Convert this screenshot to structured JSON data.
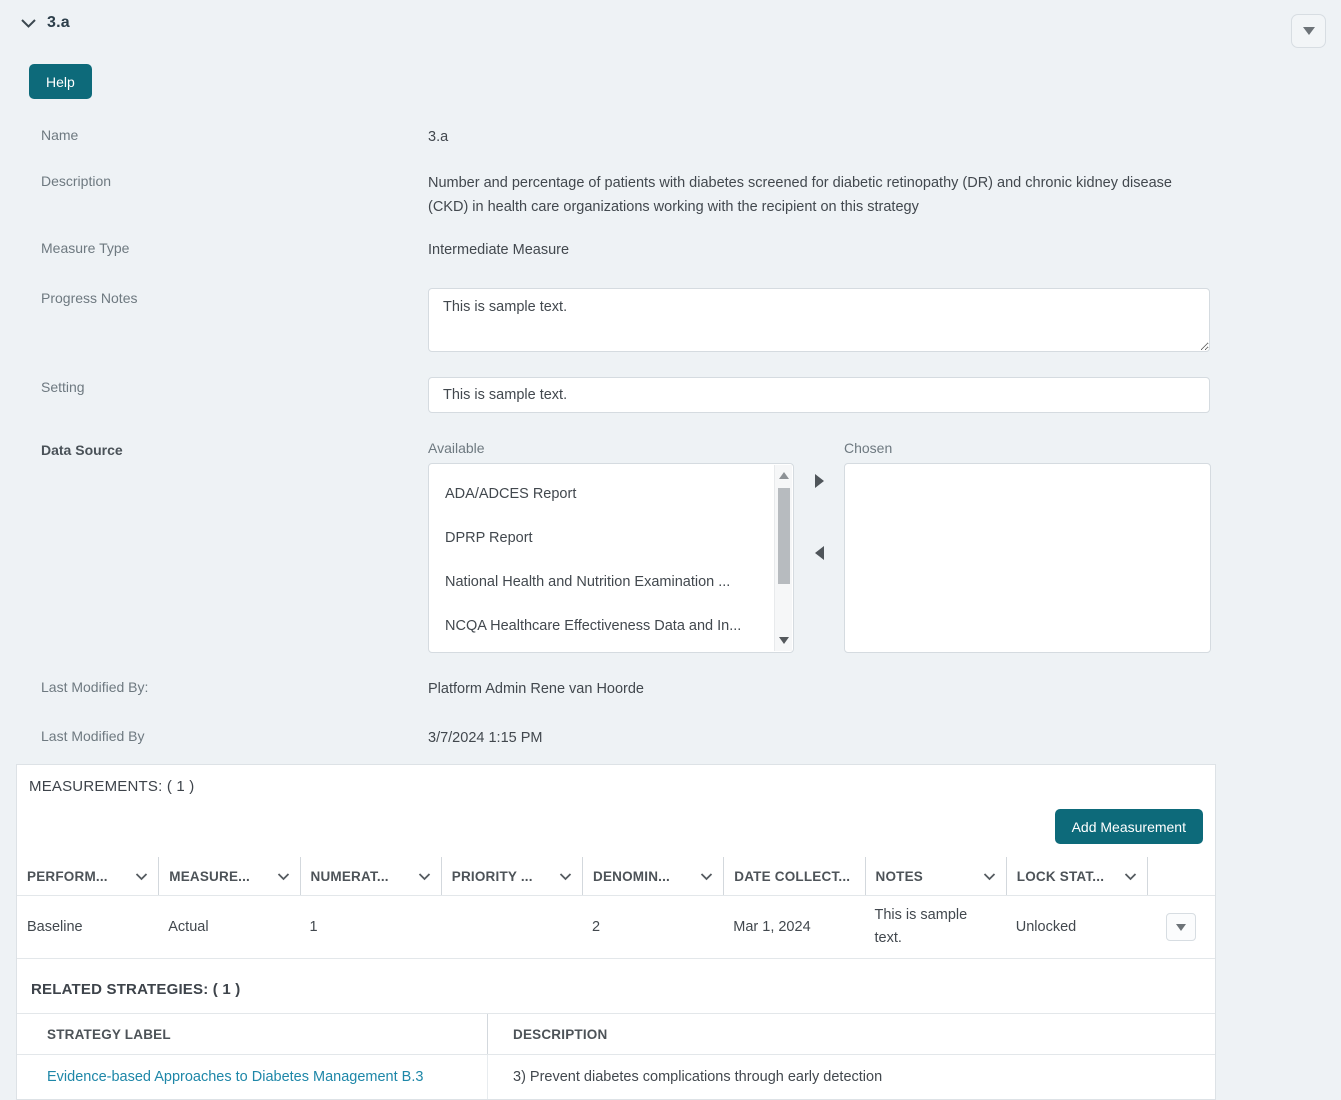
{
  "colors": {
    "accent": "#0d6a7a",
    "background": "#eef2f5",
    "link": "#1e87a8"
  },
  "header": {
    "title": "3.a",
    "help_label": "Help"
  },
  "form": {
    "name": {
      "label": "Name",
      "value": "3.a"
    },
    "description": {
      "label": "Description",
      "value": "Number and percentage of patients with diabetes screened for diabetic retinopathy (DR) and chronic kidney disease (CKD) in health care organizations working with the recipient on this strategy"
    },
    "measure_type": {
      "label": "Measure Type",
      "value": "Intermediate Measure"
    },
    "progress_notes": {
      "label": "Progress Notes",
      "value": "This is sample text."
    },
    "setting": {
      "label": "Setting",
      "value": "This is sample text."
    },
    "data_source": {
      "label": "Data Source",
      "available_label": "Available",
      "chosen_label": "Chosen",
      "options": [
        "ADA/ADCES Report",
        "DPRP Report",
        "National Health and Nutrition Examination ...",
        "NCQA Healthcare Effectiveness Data and In..."
      ]
    },
    "last_modified_by_user": {
      "label": "Last Modified By:",
      "value": "Platform Admin Rene van Hoorde"
    },
    "last_modified_date": {
      "label": "Last Modified By",
      "value": "3/7/2024 1:15 PM"
    }
  },
  "measurements": {
    "title": "MEASUREMENTS: ( 1 )",
    "add_button_label": "Add Measurement",
    "columns": [
      "PERFORM...",
      "MEASURE...",
      "NUMERAT...",
      "PRIORITY ...",
      "DENOMIN...",
      "DATE COLLECT...",
      "NOTES",
      "LOCK STAT..."
    ],
    "rows": [
      {
        "performance": "Baseline",
        "measure": "Actual",
        "numerator": "1",
        "priority": "",
        "denominator": "2",
        "date_collected": "Mar 1, 2024",
        "notes": "This is sample text.",
        "lock_status": "Unlocked"
      }
    ]
  },
  "related_strategies": {
    "title": "RELATED STRATEGIES: ( 1 )",
    "columns": {
      "label": "STRATEGY LABEL",
      "description": "DESCRIPTION"
    },
    "rows": [
      {
        "label": "Evidence-based Approaches to Diabetes Management B.3",
        "description": "3) Prevent diabetes complications through early detection"
      }
    ]
  }
}
